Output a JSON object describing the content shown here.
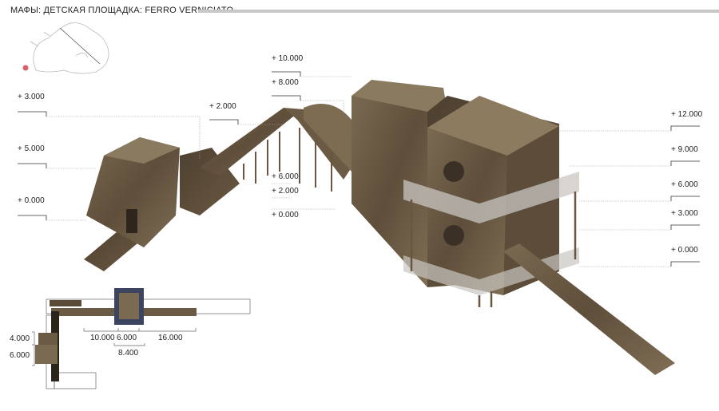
{
  "title": "МАФЫ: ДЕТСКАЯ ПЛОЩАДКА: FERRO VERNICIATO",
  "levels": {
    "left": [
      "+ 3.000",
      "+ 5.000",
      "+ 0.000"
    ],
    "bridge": "+ 2.000",
    "middle": [
      "+ 10.000",
      "+ 8.000",
      "+ 6.000",
      "+ 2.000",
      "+ 0.000"
    ],
    "right": [
      "+ 12.000",
      "+ 9.000",
      "+ 6.000",
      "+ 3.000",
      "+ 0.000"
    ]
  },
  "plan_dimensions": {
    "horizontal": [
      "10.000",
      "6.000",
      "16.000"
    ],
    "overall": "8.400",
    "vertical": [
      "4.000",
      "6.000"
    ]
  },
  "colors": {
    "material": "#6b5a44",
    "location_marker": "#d9606a",
    "tower_outline": "#3b4560"
  }
}
